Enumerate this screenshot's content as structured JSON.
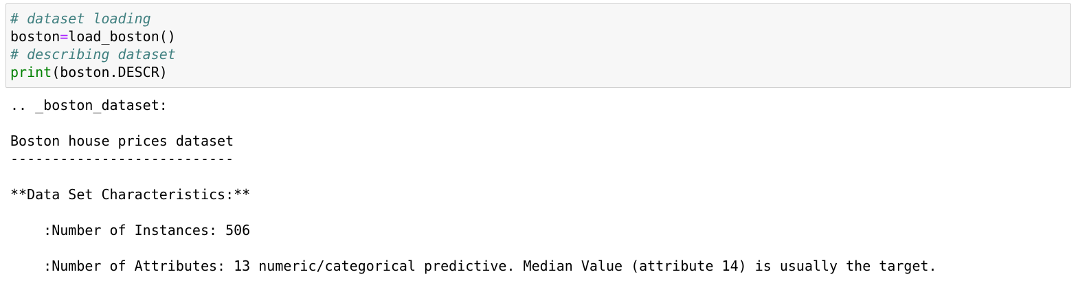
{
  "code_cell": {
    "lines": [
      {
        "comment": "# dataset loading"
      },
      {
        "var": "boston",
        "op": "=",
        "call": "load_boston()"
      },
      {
        "comment": "# describing dataset"
      },
      {
        "builtin": "print",
        "args": "(boston.DESCR)"
      }
    ]
  },
  "output": {
    "lines": [
      ".. _boston_dataset:",
      "",
      "Boston house prices dataset",
      "---------------------------",
      "",
      "**Data Set Characteristics:**",
      "",
      "    :Number of Instances: 506",
      "",
      "    :Number of Attributes: 13 numeric/categorical predictive. Median Value (attribute 14) is usually the target."
    ]
  },
  "colors": {
    "cell_background": "#f7f7f7",
    "cell_border": "#cfcfcf",
    "comment": "#408080",
    "operator": "#aa22ff",
    "builtin": "#008000"
  }
}
